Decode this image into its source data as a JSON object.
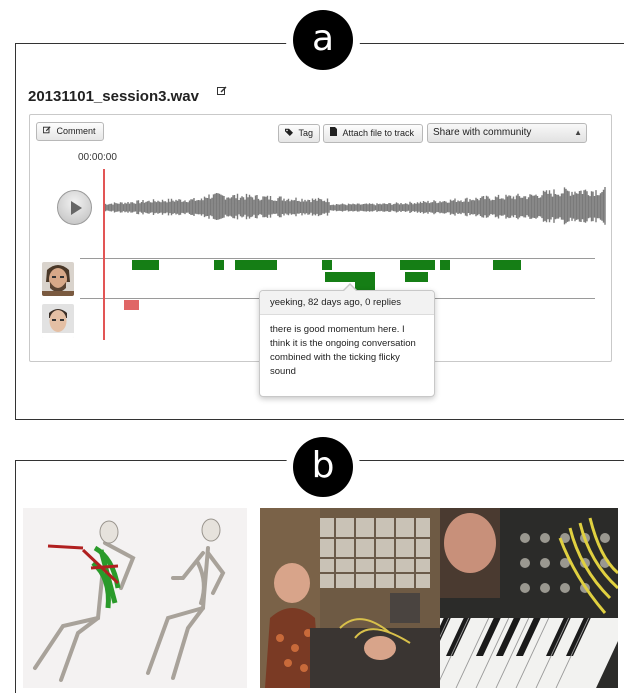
{
  "figure": {
    "panel_a_label": "a",
    "panel_b_label": "b"
  },
  "track": {
    "title": "20131101_session3.wav"
  },
  "toolbar": {
    "comment_label": "Comment",
    "tag_label": "Tag",
    "attach_label": "Attach file to track",
    "share_selected": "Share with community"
  },
  "player": {
    "timecode": "00:00:00"
  },
  "annotations": {
    "user1": [
      {
        "start": 0.055,
        "end": 0.11
      },
      {
        "start": 0.22,
        "end": 0.24
      },
      {
        "start": 0.26,
        "end": 0.345
      },
      {
        "start": 0.435,
        "end": 0.455
      },
      {
        "start": 0.44,
        "end": 0.54,
        "row": 2
      },
      {
        "start": 0.5,
        "end": 0.54,
        "row": 3
      },
      {
        "start": 0.59,
        "end": 0.66
      },
      {
        "start": 0.6,
        "end": 0.645,
        "row": 2
      },
      {
        "start": 0.67,
        "end": 0.69
      },
      {
        "start": 0.775,
        "end": 0.83
      }
    ],
    "user2": [
      {
        "start": 0.04,
        "end": 0.07
      }
    ]
  },
  "popover": {
    "header": "yeeking, 82 days ago, 0 replies",
    "body": "there is good momentum here. I think it is the ongoing conversation combined with the ticking flicky sound"
  },
  "colors": {
    "annotation_green": "#157e15",
    "annotation_red": "#e06666",
    "playhead": "#e25555",
    "waveform": "#7a7a7a"
  },
  "icons": [
    "edit-icon",
    "comment-icon",
    "tag-icon",
    "file-icon",
    "play-icon",
    "chevron-updown-icon"
  ]
}
